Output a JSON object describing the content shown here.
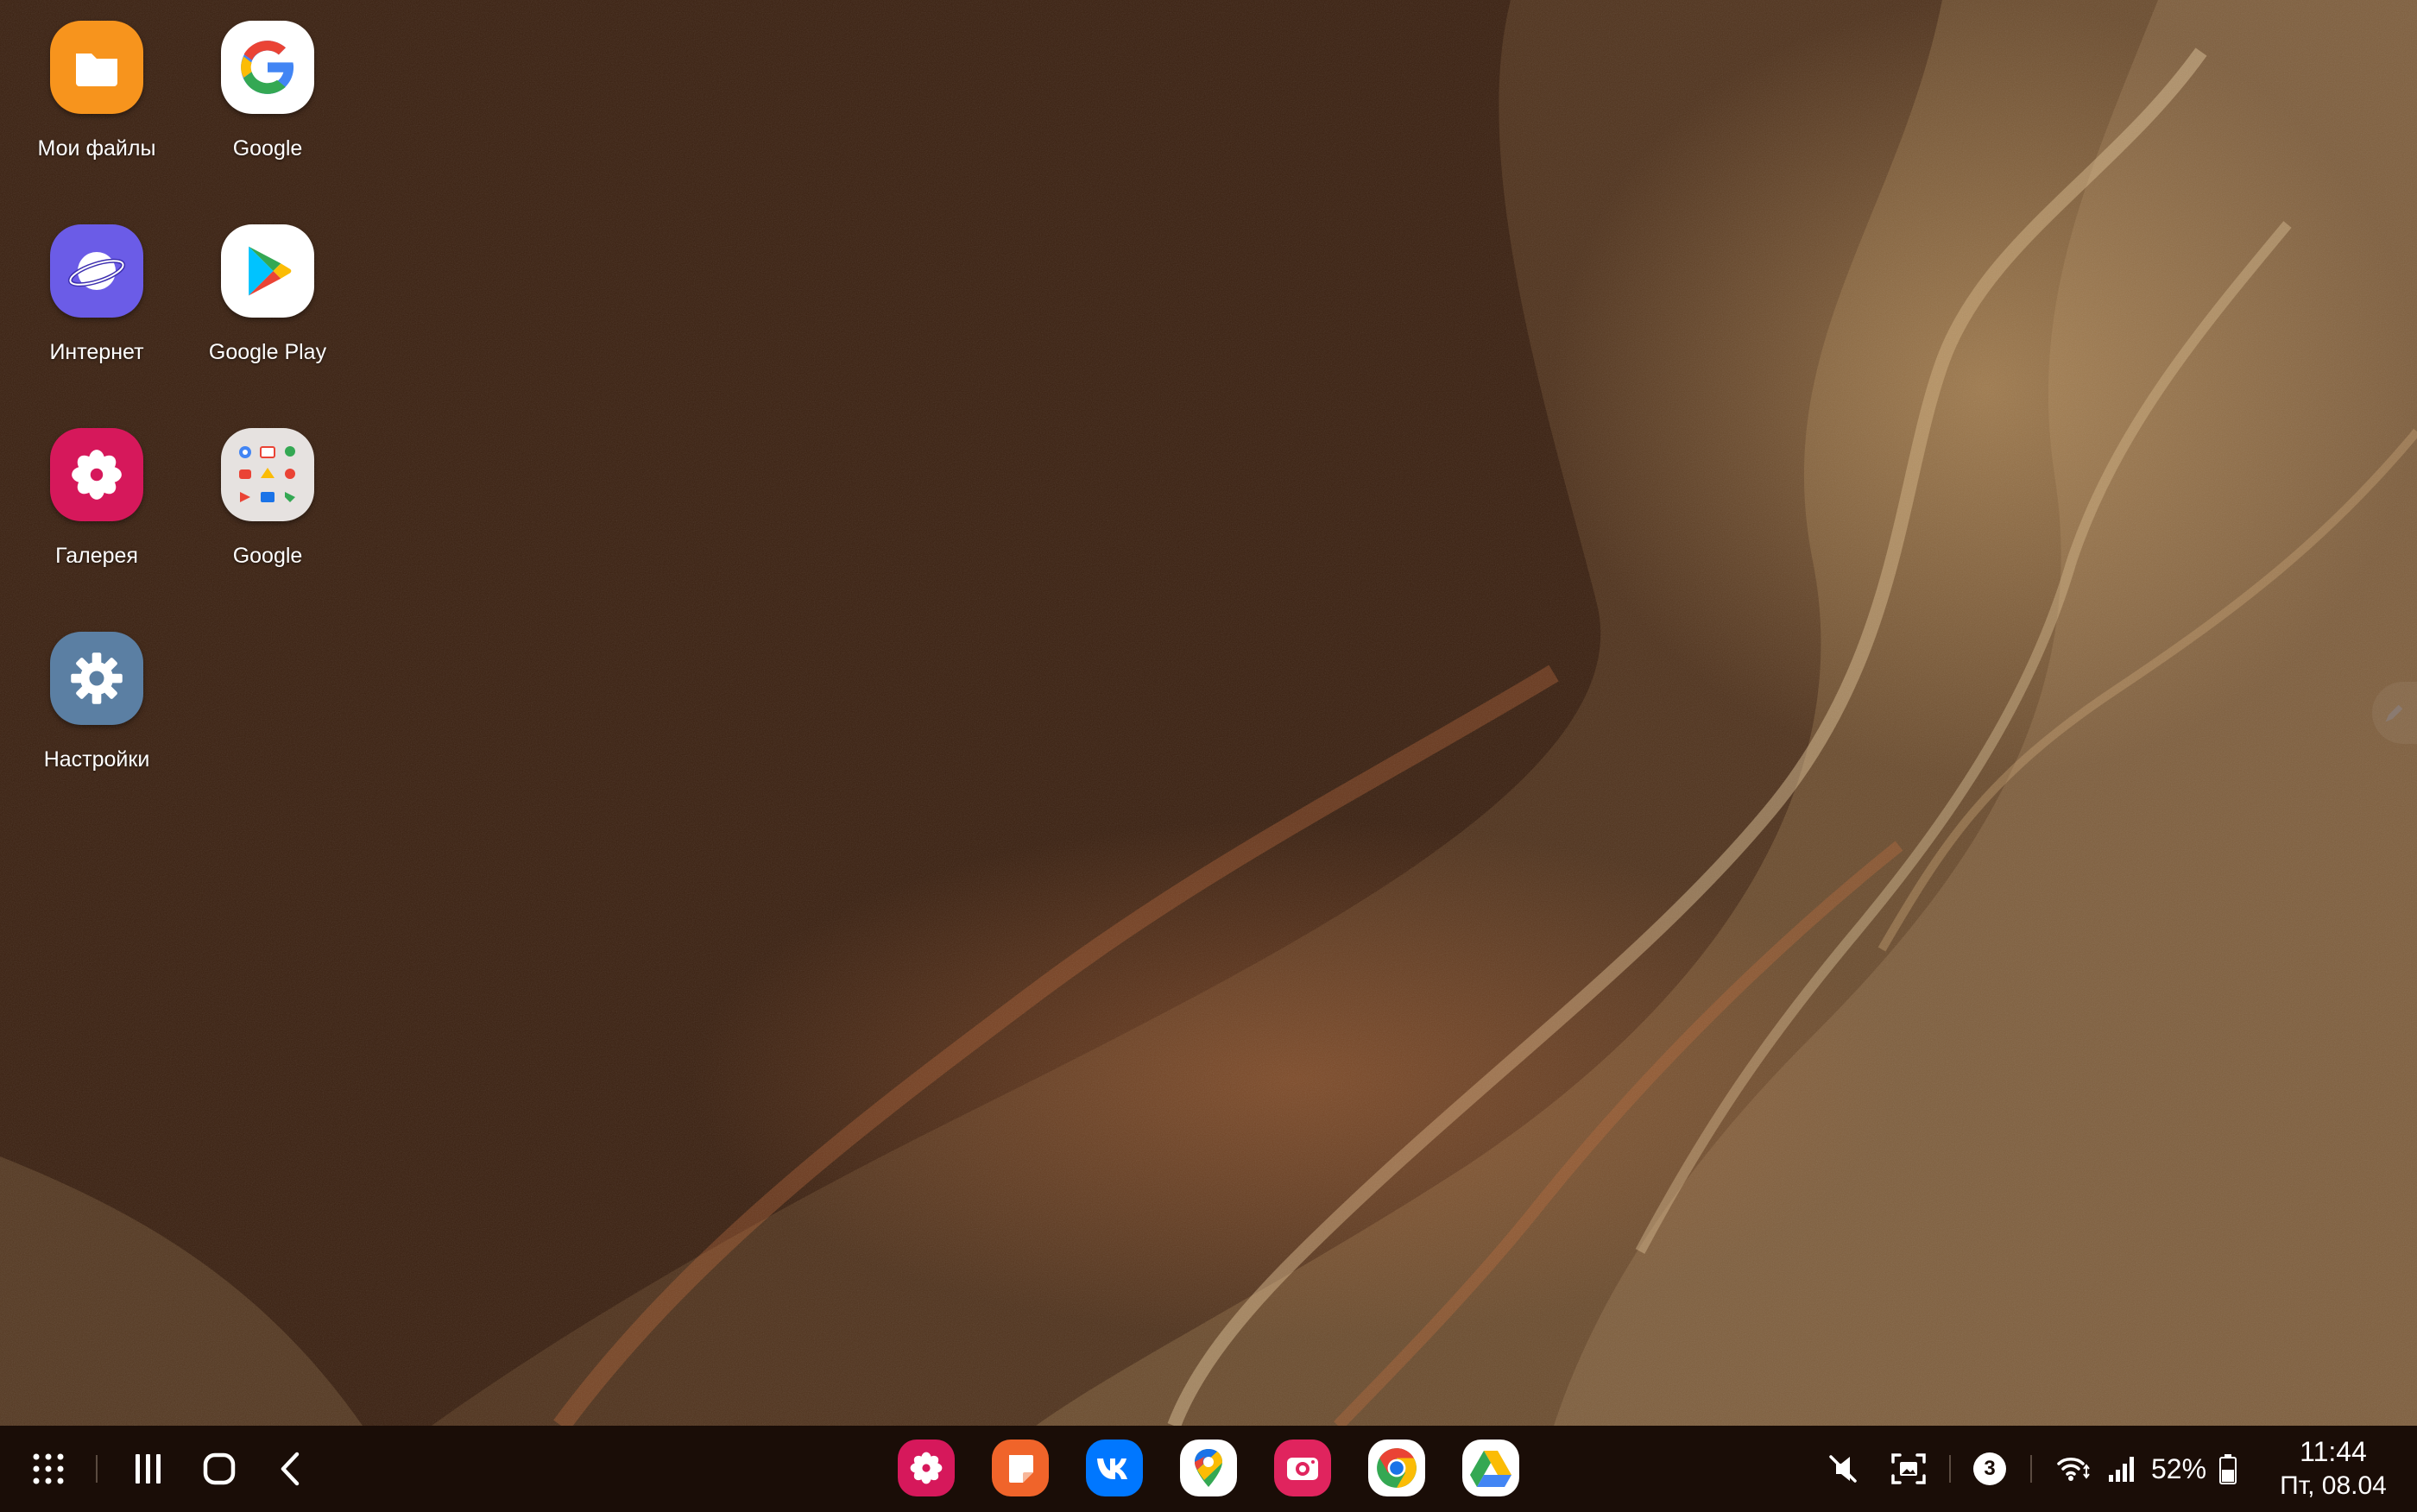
{
  "desktop": {
    "apps": [
      {
        "label": "Мои файлы"
      },
      {
        "label": "Google"
      },
      {
        "label": "Интернет"
      },
      {
        "label": "Google Play"
      },
      {
        "label": "Галерея"
      },
      {
        "label": "Google"
      },
      {
        "label": "Настройки"
      }
    ]
  },
  "taskbar": {
    "dock_apps": [
      {
        "icon": "gallery-icon"
      },
      {
        "icon": "samsung-notes-icon"
      },
      {
        "icon": "vk-icon"
      },
      {
        "icon": "google-maps-icon"
      },
      {
        "icon": "screen-recorder-icon"
      },
      {
        "icon": "chrome-icon"
      },
      {
        "icon": "google-drive-icon"
      }
    ],
    "status": {
      "notification_count": "3",
      "battery": "52%",
      "time": "11:44",
      "date": "Пт, 08.04"
    }
  },
  "colors": {
    "wallpaper_bg": "#3a2010",
    "taskbar_bg": "#1a0d07",
    "files_orange": "#f7941d",
    "internet_purple": "#6b5ce7",
    "gallery_pink": "#d6185b",
    "settings_slate": "#5b7fa3"
  }
}
